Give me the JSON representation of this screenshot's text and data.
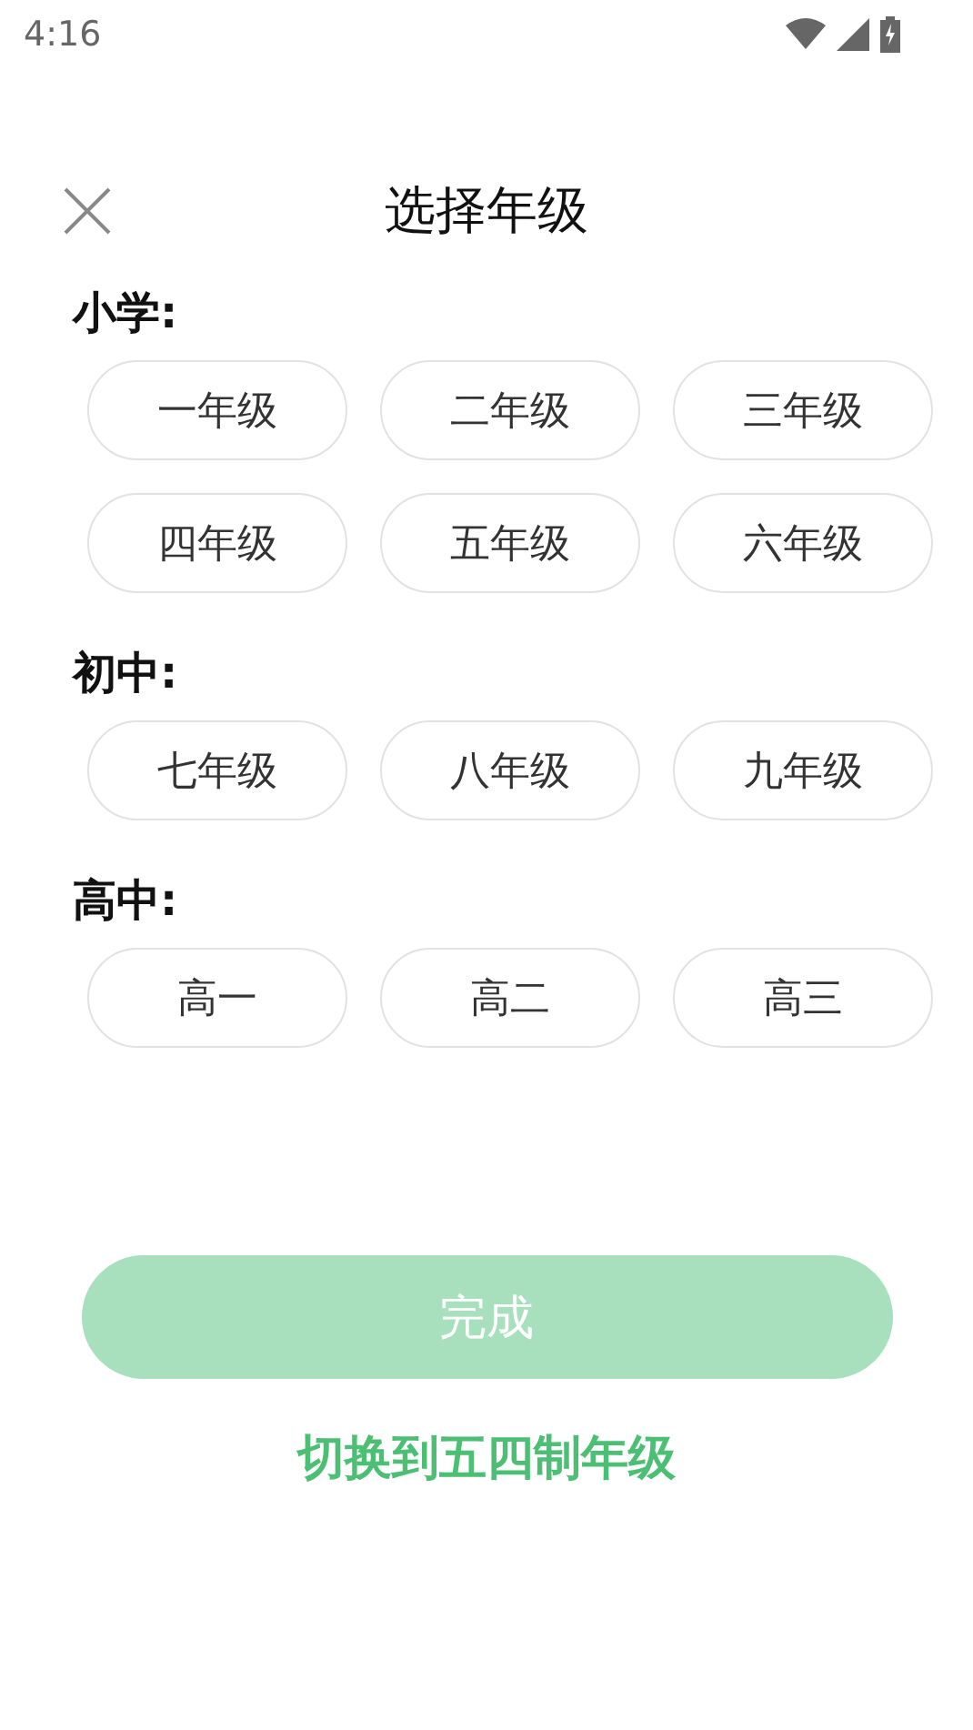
{
  "status_bar": {
    "time": "4:16"
  },
  "header": {
    "title": "选择年级"
  },
  "sections": [
    {
      "label": "小学:",
      "grades": [
        {
          "label": "一年级",
          "selected": false
        },
        {
          "label": "二年级",
          "selected": false
        },
        {
          "label": "三年级",
          "selected": false
        },
        {
          "label": "四年级",
          "selected": false
        },
        {
          "label": "五年级",
          "selected": false
        },
        {
          "label": "六年级",
          "selected": false
        }
      ]
    },
    {
      "label": "初中:",
      "grades": [
        {
          "label": "七年级",
          "selected": false
        },
        {
          "label": "八年级",
          "selected": false
        },
        {
          "label": "九年级",
          "selected": false
        }
      ]
    },
    {
      "label": "高中:",
      "grades": [
        {
          "label": "高一",
          "selected": false
        },
        {
          "label": "高二",
          "selected": false
        },
        {
          "label": "高三",
          "selected": false
        }
      ]
    }
  ],
  "done_button": {
    "label": "完成",
    "disabled": true
  },
  "switch_link": "切换到五四制年级"
}
